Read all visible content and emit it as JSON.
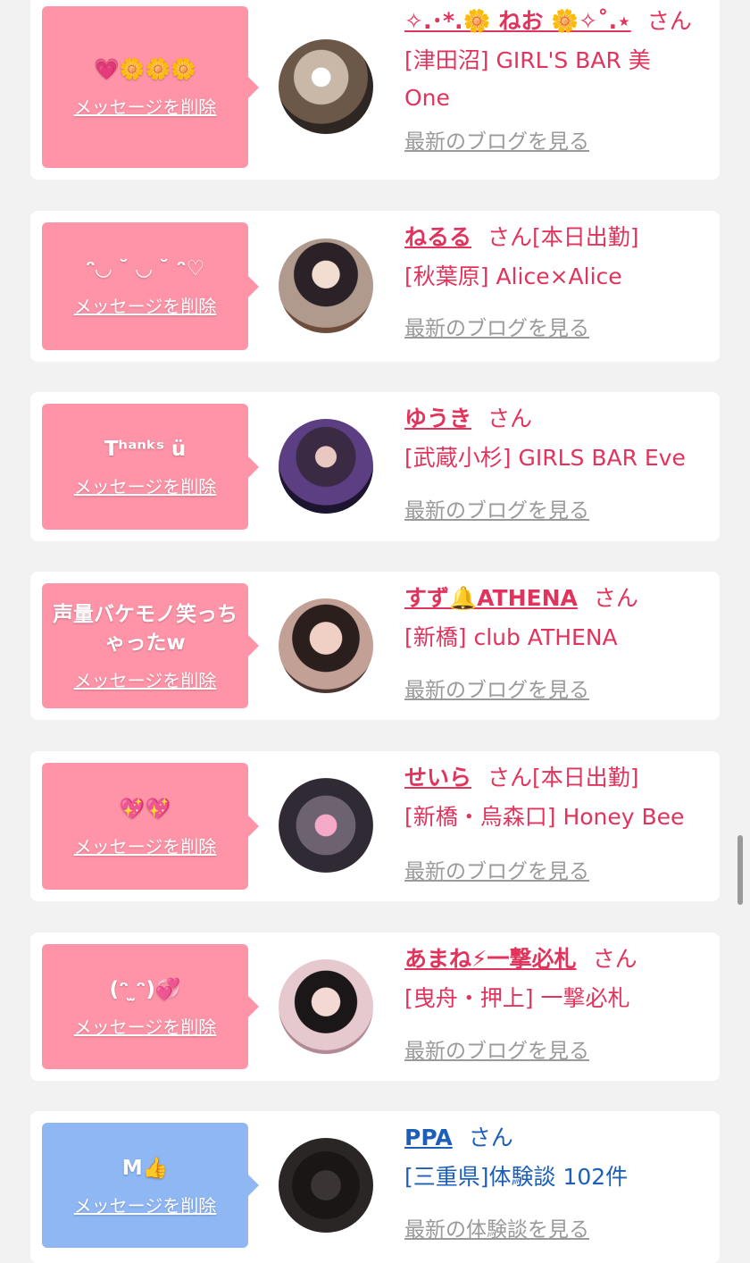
{
  "entries": [
    {
      "message": "💗🌼🌼🌼",
      "delete_label": "メッセージを削除",
      "name": "✧.･*.🌼 ねお 🌼✧˚.⋆",
      "suffix": "さん",
      "status": "",
      "shop": "[津田沼] GIRL'S BAR 美One",
      "link": "最新のブログを見る",
      "bubble_color": "#ff94a8",
      "text_color": "#e0345d"
    },
    {
      "message": "ᵔ◡ ˘ ◡ ˘ ᵔ♡",
      "delete_label": "メッセージを削除",
      "name": "ねるる",
      "suffix": "さん",
      "status": "[本日出勤]",
      "shop": "[秋葉原] Alice×Alice",
      "link": "最新のブログを見る",
      "bubble_color": "#ff94a8",
      "text_color": "#e0345d"
    },
    {
      "message": "Tʰᵃⁿᵏˢ ü",
      "delete_label": "メッセージを削除",
      "name": "ゆうき",
      "suffix": "さん",
      "status": "",
      "shop": "[武蔵小杉] GIRLS BAR Eve",
      "link": "最新のブログを見る",
      "bubble_color": "#ff94a8",
      "text_color": "#e0345d"
    },
    {
      "message": "声量バケモノ笑っちゃったw",
      "delete_label": "メッセージを削除",
      "name": "すず🔔ATHENA",
      "suffix": "さん",
      "status": "",
      "shop": "[新橋] club ATHENA",
      "link": "最新のブログを見る",
      "bubble_color": "#ff94a8",
      "text_color": "#e0345d"
    },
    {
      "message": "💖💖",
      "delete_label": "メッセージを削除",
      "name": "せいら",
      "suffix": "さん",
      "status": "[本日出勤]",
      "shop": "[新橋・烏森口] Honey Bee",
      "link": "最新のブログを見る",
      "bubble_color": "#ff94a8",
      "text_color": "#e0345d"
    },
    {
      "message": "(ᵔ ̫ᵔ)💞",
      "delete_label": "メッセージを削除",
      "name": "あまね⚡一撃必札",
      "suffix": "さん",
      "status": "",
      "shop": "[曳舟・押上] 一撃必札",
      "link": "最新のブログを見る",
      "bubble_color": "#ff94a8",
      "text_color": "#e0345d"
    },
    {
      "message": "M👍",
      "delete_label": "メッセージを削除",
      "name": "PPA",
      "suffix": "さん",
      "status": "",
      "shop": "[三重県]体験談 102件",
      "link": "最新の体験談を見る",
      "bubble_color": "#8fb7f4",
      "text_color": "#1d5fb8"
    }
  ],
  "colors": {
    "page_background": "#f2f2f2",
    "card_background": "#ffffff",
    "link_gray": "#9a9a9a"
  }
}
